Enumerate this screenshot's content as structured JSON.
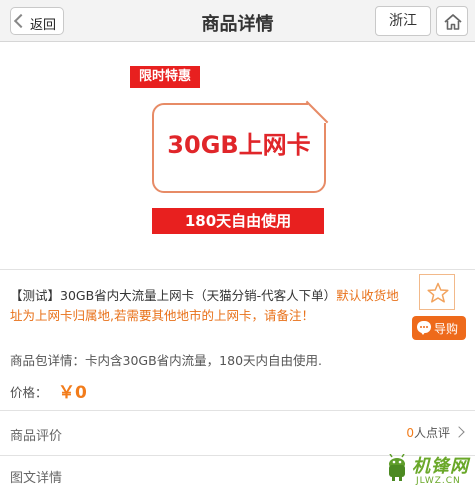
{
  "header": {
    "back_label": "返回",
    "title": "商品详情",
    "region_label": "浙江"
  },
  "banner": {
    "promo_tag": "限时特惠",
    "card_text": "30GB上网卡",
    "days_text": "180天自由使用"
  },
  "product": {
    "name": "【测试】30GB省内大流量上网卡（天猫分销-代客人下单）",
    "note": "默认收货地址为上网卡归属地,若需要其他地市的上网卡，请备注！",
    "guide_label": "导购"
  },
  "details": {
    "package_label": "商品包详情：",
    "package_text": "卡内含30GB省内流量，180天内自由使用.",
    "price_label": "价格：",
    "price_value": "￥0"
  },
  "reviews": {
    "label": "商品评价",
    "count": "0",
    "count_suffix": "人点评"
  },
  "graphic_detail": {
    "label": "图文详情"
  },
  "watermark": {
    "text": "机锋网",
    "url": "JLWZ.CN"
  },
  "colors": {
    "accent_orange": "#f27c1b",
    "promo_red": "#e8201f",
    "watermark_green": "#6aa829"
  }
}
